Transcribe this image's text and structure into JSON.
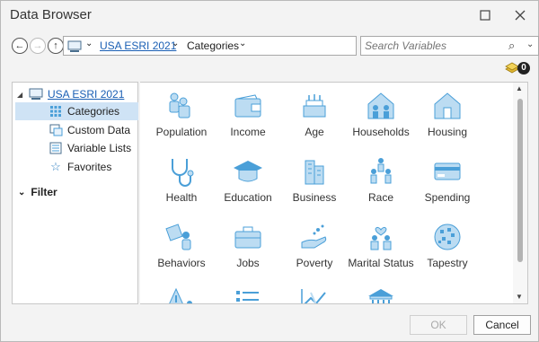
{
  "window": {
    "title": "Data Browser"
  },
  "toolbar": {
    "crumb_root": "USA ESRI 2021",
    "crumb_current": "Categories",
    "search_placeholder": "Search Variables",
    "layer_count": "0"
  },
  "tree": {
    "root": "USA ESRI 2021",
    "items": [
      {
        "label": "Categories",
        "icon": "grid-icon"
      },
      {
        "label": "Custom Data",
        "icon": "custom-data-icon"
      },
      {
        "label": "Variable Lists",
        "icon": "list-icon"
      },
      {
        "label": "Favorites",
        "icon": "star-icon"
      }
    ],
    "filter": "Filter"
  },
  "categories": [
    {
      "label": "Population",
      "icon": "population-icon"
    },
    {
      "label": "Income",
      "icon": "wallet-icon"
    },
    {
      "label": "Age",
      "icon": "cake-icon"
    },
    {
      "label": "Households",
      "icon": "household-icon"
    },
    {
      "label": "Housing",
      "icon": "house-icon"
    },
    {
      "label": "Health",
      "icon": "stethoscope-icon"
    },
    {
      "label": "Education",
      "icon": "graduation-cap-icon"
    },
    {
      "label": "Business",
      "icon": "buildings-icon"
    },
    {
      "label": "Race",
      "icon": "race-people-icon"
    },
    {
      "label": "Spending",
      "icon": "credit-card-icon"
    },
    {
      "label": "Behaviors",
      "icon": "behaviors-icon"
    },
    {
      "label": "Jobs",
      "icon": "briefcase-icon"
    },
    {
      "label": "Poverty",
      "icon": "poverty-hand-icon"
    },
    {
      "label": "Marital Status",
      "icon": "marital-status-icon"
    },
    {
      "label": "Tapestry",
      "icon": "tapestry-globe-icon"
    },
    {
      "label": "",
      "icon": "warning-person-icon"
    },
    {
      "label": "",
      "icon": "checklist-icon"
    },
    {
      "label": "",
      "icon": "trend-chart-icon"
    },
    {
      "label": "",
      "icon": "government-building-icon"
    }
  ],
  "buttons": {
    "ok": "OK",
    "cancel": "Cancel"
  },
  "colors": {
    "icon_blue": "#4a9fd8",
    "link_blue": "#1a5fb4",
    "selected_bg": "#cfe3f5"
  }
}
